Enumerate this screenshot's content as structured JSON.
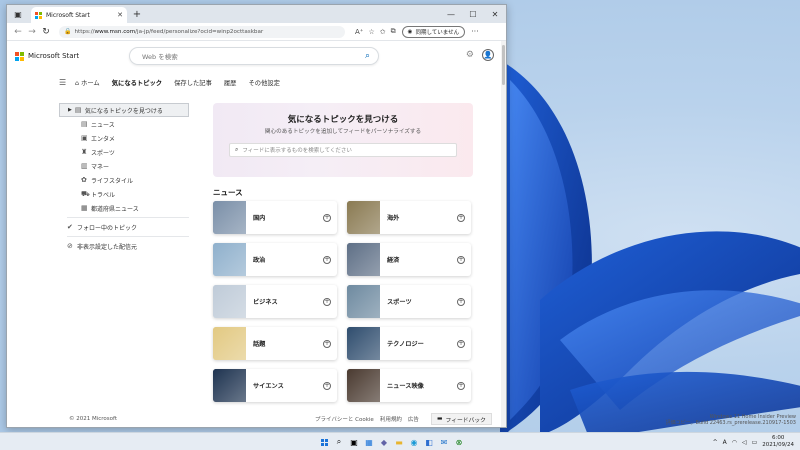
{
  "browser": {
    "tab_title": "Microsoft Start",
    "url_prefix": "https://",
    "url_domain": "www.msn.com",
    "url_path": "/ja-jp/feed/personalize?ocid=winp2octtaskbar",
    "sync_label": "同期していません"
  },
  "header": {
    "brand": "Microsoft Start",
    "search_placeholder": "Web を検索"
  },
  "nav": {
    "home": "ホーム",
    "items": [
      "気になるトピック",
      "保存した記事",
      "履歴",
      "その他設定"
    ],
    "active_index": 0
  },
  "sidebar": {
    "main_item": "気になるトピックを見つける",
    "sub_items": [
      {
        "label": "ニュース",
        "icon": "newspaper-icon"
      },
      {
        "label": "エンタメ",
        "icon": "film-icon"
      },
      {
        "label": "スポーツ",
        "icon": "trophy-icon"
      },
      {
        "label": "マネー",
        "icon": "chart-icon"
      },
      {
        "label": "ライフスタイル",
        "icon": "plant-icon"
      },
      {
        "label": "トラベル",
        "icon": "car-icon"
      },
      {
        "label": "都道府県ニュース",
        "icon": "building-icon"
      }
    ],
    "following": "フォロー中のトピック",
    "hidden": "非表示設定した配信元"
  },
  "hero": {
    "title": "気になるトピックを見つける",
    "subtitle": "関心のあるトピックを追加してフィードをパーソナライズする",
    "search_placeholder": "フィードに表示するものを検索してください"
  },
  "news": {
    "title": "ニュース",
    "cards": [
      {
        "label": "国内",
        "thumb": "#7a8fa8"
      },
      {
        "label": "海外",
        "thumb": "#8a7a52"
      },
      {
        "label": "政治",
        "thumb": "#8fb0cc"
      },
      {
        "label": "経済",
        "thumb": "#5e6f86"
      },
      {
        "label": "ビジネス",
        "thumb": "#bfcbd8"
      },
      {
        "label": "スポーツ",
        "thumb": "#6e8aa0"
      },
      {
        "label": "話題",
        "thumb": "#e2c982"
      },
      {
        "label": "テクノロジー",
        "thumb": "#2f4d6e"
      },
      {
        "label": "サイエンス",
        "thumb": "#1e3350"
      },
      {
        "label": "ニュース映像",
        "thumb": "#4a3a30"
      }
    ]
  },
  "footer": {
    "copyright": "© 2021 Microsoft",
    "links": [
      "プライバシーと Cookie",
      "利用規約",
      "広告"
    ],
    "feedback": "フィードバック"
  },
  "desktop": {
    "watermark_line1": "Windows 11 Home Insider Preview",
    "watermark_line2": "評価コピー。Build 22463.rs_prerelease.210917-1503"
  },
  "taskbar": {
    "lang": "A",
    "time": "6:00",
    "date": "2021/09/24"
  },
  "colors": {
    "accent": "#0067b8",
    "ms_red": "#f25022",
    "ms_green": "#7fba00",
    "ms_blue": "#00a4ef",
    "ms_yellow": "#ffb900"
  }
}
